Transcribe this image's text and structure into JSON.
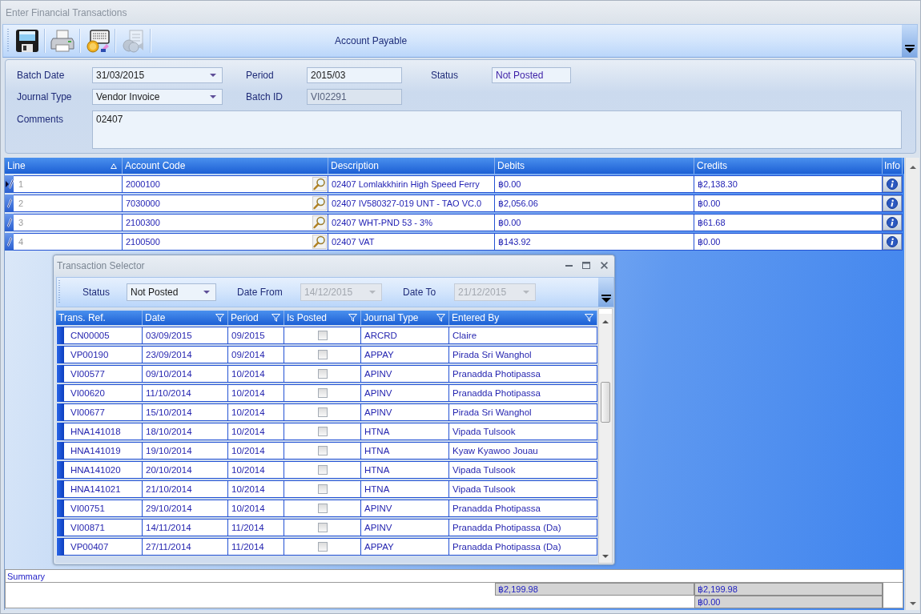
{
  "window": {
    "title": "Enter Financial Transactions"
  },
  "toolbar": {
    "buttons": [
      {
        "kind": "save",
        "disabled": false
      },
      {
        "kind": "print",
        "disabled": false
      },
      {
        "kind": "keyboard",
        "disabled": false
      },
      {
        "kind": "coins",
        "disabled": true
      }
    ],
    "title": "Account Payable"
  },
  "form": {
    "rows": [
      [
        {
          "label": "Batch Date",
          "value": "31/03/2015",
          "kind": "dropdown"
        },
        {
          "label": "Period",
          "value": "2015/03",
          "kind": "text"
        },
        {
          "label": "Status",
          "value": "Not Posted",
          "kind": "status"
        }
      ],
      [
        {
          "label": "Journal Type",
          "value": "Vendor Invoice",
          "kind": "dropdown"
        },
        {
          "label": "Batch ID",
          "value": "VI02291",
          "kind": "readonly"
        }
      ],
      [
        {
          "label": "Comments",
          "value": "02407",
          "kind": "memo"
        }
      ]
    ]
  },
  "grid": {
    "columns": [
      {
        "label": "Line",
        "sorted": true
      },
      {
        "label": "Account Code",
        "sorted": false
      },
      {
        "label": "Description",
        "sorted": false
      },
      {
        "label": "Debits",
        "sorted": false
      },
      {
        "label": "Credits",
        "sorted": false
      },
      {
        "label": "Info",
        "sorted": false
      }
    ],
    "rows": [
      {
        "line": "1",
        "account_code": "2000100",
        "description": "02407 Lomlakkhirin High Speed Ferry",
        "debits": "฿0.00",
        "credits": "฿2,138.30",
        "selected": true
      },
      {
        "line": "2",
        "account_code": "7030000",
        "description": "02407 IV580327-019 UNT - TAO VC.0",
        "debits": "฿2,056.06",
        "credits": "฿0.00",
        "selected": false
      },
      {
        "line": "3",
        "account_code": "2100300",
        "description": "02407 WHT-PND 53 - 3%",
        "debits": "฿0.00",
        "credits": "฿61.68",
        "selected": false
      },
      {
        "line": "4",
        "account_code": "2100500",
        "description": "02407 VAT",
        "debits": "฿143.92",
        "credits": "฿0.00",
        "selected": false
      }
    ]
  },
  "summary": {
    "label": "Summary",
    "rows": [
      {
        "debits": "฿2,199.98",
        "credits": "฿2,199.98"
      },
      {
        "credits": "฿0.00"
      }
    ]
  },
  "transaction_selector": {
    "title": "Transaction Selector",
    "filters": [
      {
        "label": "Status",
        "value": "Not Posted",
        "disabled": false
      },
      {
        "label": "Date From",
        "value": "14/12/2015",
        "disabled": true
      },
      {
        "label": "Date To",
        "value": "21/12/2015",
        "disabled": true
      }
    ],
    "columns": [
      {
        "label": "Trans. Ref.",
        "filter": false
      },
      {
        "label": "Date",
        "filter": true
      },
      {
        "label": "Period",
        "filter": true
      },
      {
        "label": "Is Posted",
        "filter": true
      },
      {
        "label": "Journal Type",
        "filter": true
      },
      {
        "label": "Entered By",
        "filter": true
      }
    ],
    "rows": [
      {
        "trans_ref": "CN00005",
        "date": "03/09/2015",
        "period": "09/2015",
        "is_posted": false,
        "journal_type": "ARCRD",
        "entered_by": "Claire"
      },
      {
        "trans_ref": "VP00190",
        "date": "23/09/2014",
        "period": "09/2014",
        "is_posted": false,
        "journal_type": "APPAY",
        "entered_by": "Pirada Sri Wanghol"
      },
      {
        "trans_ref": "VI00577",
        "date": "09/10/2014",
        "period": "10/2014",
        "is_posted": false,
        "journal_type": "APINV",
        "entered_by": "Pranadda Photipassa"
      },
      {
        "trans_ref": "VI00620",
        "date": "11/10/2014",
        "period": "10/2014",
        "is_posted": false,
        "journal_type": "APINV",
        "entered_by": "Pranadda Photipassa"
      },
      {
        "trans_ref": "VI00677",
        "date": "15/10/2014",
        "period": "10/2014",
        "is_posted": false,
        "journal_type": "APINV",
        "entered_by": "Pirada Sri Wanghol"
      },
      {
        "trans_ref": "HNA141018",
        "date": "18/10/2014",
        "period": "10/2014",
        "is_posted": false,
        "journal_type": "HTNA",
        "entered_by": "Vipada Tulsook"
      },
      {
        "trans_ref": "HNA141019",
        "date": "19/10/2014",
        "period": "10/2014",
        "is_posted": false,
        "journal_type": "HTNA",
        "entered_by": "Kyaw Kyawoo Jouau"
      },
      {
        "trans_ref": "HNA141020",
        "date": "20/10/2014",
        "period": "10/2014",
        "is_posted": false,
        "journal_type": "HTNA",
        "entered_by": "Vipada Tulsook"
      },
      {
        "trans_ref": "HNA141021",
        "date": "21/10/2014",
        "period": "10/2014",
        "is_posted": false,
        "journal_type": "HTNA",
        "entered_by": "Vipada Tulsook"
      },
      {
        "trans_ref": "VI00751",
        "date": "29/10/2014",
        "period": "10/2014",
        "is_posted": false,
        "journal_type": "APINV",
        "entered_by": "Pranadda Photipassa"
      },
      {
        "trans_ref": "VI00871",
        "date": "14/11/2014",
        "period": "11/2014",
        "is_posted": false,
        "journal_type": "APINV",
        "entered_by": "Pranadda Photipassa (Da)"
      },
      {
        "trans_ref": "VP00407",
        "date": "27/11/2014",
        "period": "11/2014",
        "is_posted": false,
        "journal_type": "APPAY",
        "entered_by": "Pranadda Photipassa (Da)"
      }
    ]
  }
}
